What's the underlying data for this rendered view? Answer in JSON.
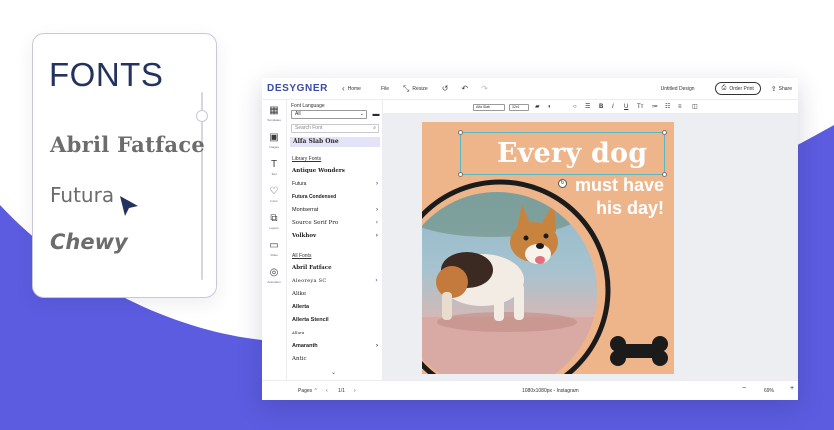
{
  "colors": {
    "accent": "#5b5ce0",
    "brand": "#3a4aa8",
    "poster_bg": "#eeb58b",
    "selection": "#e4e2f7"
  },
  "card": {
    "title": "FONTS",
    "fonts": [
      "Abril Fatface",
      "Futura",
      "Chewy"
    ],
    "cursor_icon": "cursor-arrow-icon"
  },
  "app": {
    "logo": "DESYGNER",
    "toolbar": {
      "home_label": "Home",
      "file_label": "File",
      "resize_label": "Resize",
      "doc_title": "Untitled Design",
      "order_label": "Order Print",
      "share_label": "Share"
    },
    "rail": [
      {
        "icon": "templates-icon",
        "label": "Templates"
      },
      {
        "icon": "images-icon",
        "label": "Images"
      },
      {
        "icon": "text-icon",
        "label": "Text"
      },
      {
        "icon": "icons-icon",
        "label": "Icons"
      },
      {
        "icon": "layers-icon",
        "label": "Layers"
      },
      {
        "icon": "video-icon",
        "label": "Video"
      },
      {
        "icon": "animation-icon",
        "label": "Animation"
      }
    ],
    "font_panel": {
      "heading": "Font Language",
      "language_value": "All",
      "search_placeholder": "Search Font",
      "selected_font": "Alfa Slab One",
      "library_heading": "Library Fonts",
      "library_fonts": [
        "Antique Wonders",
        "Futura",
        "Futura Condensed",
        "Montserrat",
        "Source Serif Pro",
        "Volkhov"
      ],
      "all_heading": "All Fonts",
      "all_fonts": [
        "Abril Fatface",
        "Aleoreya SC",
        "Alike",
        "Allerta",
        "Allerta Stencil",
        "Allura",
        "Amaranth",
        "Antic"
      ]
    },
    "format_bar": {
      "font_select": "Alfa Slab",
      "size_select": "32x1"
    },
    "poster": {
      "line1": "Every dog",
      "line2": "must have",
      "line3": "his day!"
    },
    "bottom": {
      "pages_label": "Pages",
      "page_counter": "1/1",
      "dimensions": "1080x1080px - Instagram",
      "zoom": "69%"
    }
  }
}
